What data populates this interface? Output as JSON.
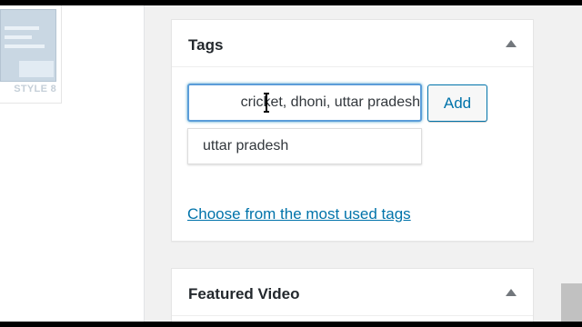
{
  "thumbnail": {
    "label": "STYLE 8"
  },
  "tags_box": {
    "title": "Tags",
    "input_value": "cricket, dhoni, uttar pradesh",
    "add_label": "Add",
    "suggestions": [
      "uttar pradesh"
    ],
    "most_used_link": "Choose from the most used tags"
  },
  "video_box": {
    "title": "Featured Video"
  },
  "colors": {
    "accent": "#0073aa",
    "focus": "#5b9dd9",
    "sidebar_bg": "#f1f1f1"
  },
  "icons": [
    "collapse-arrow-icon",
    "ibeam-cursor-icon"
  ]
}
